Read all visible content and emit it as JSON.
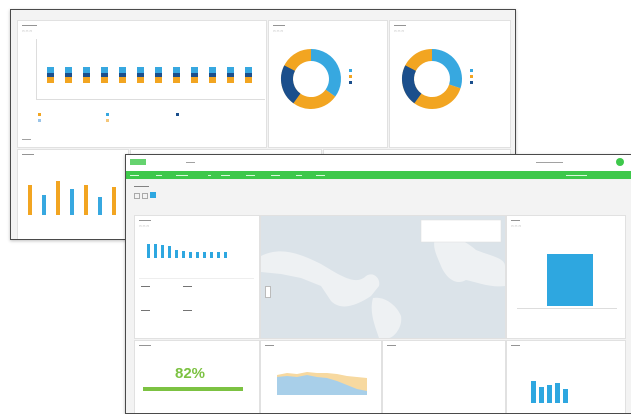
{
  "back_screen": {
    "bars": [
      0.62,
      0.62,
      0.62,
      0.62,
      0.62,
      0.62,
      0.62,
      0.62,
      0.62,
      0.62,
      0.62,
      0.62
    ],
    "donut1": [
      0.35,
      0.65
    ],
    "donut2": [
      0.3,
      0.7
    ],
    "colors": {
      "blue": "#1f6fb2",
      "lightblue": "#37a8e0",
      "orange": "#f2a521",
      "darkblue": "#1b4f8c"
    },
    "kpi_value": ""
  },
  "front_screen": {
    "kpi_value": "82%",
    "colors": {
      "green": "#3ec84b",
      "kpi_green": "#7cc242",
      "accent": "#2ea7e0",
      "map_land": "#e7ebee",
      "map_water": "#d5dee4"
    }
  }
}
